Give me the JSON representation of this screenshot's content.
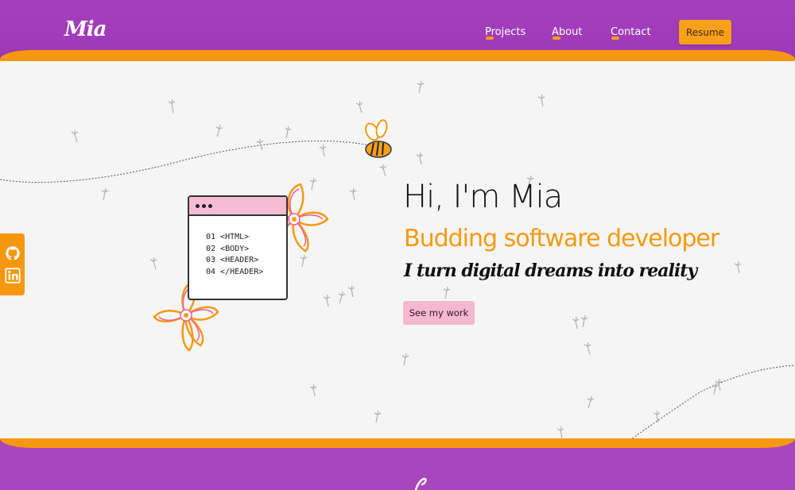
{
  "header": {
    "logo": "Mia",
    "nav": [
      {
        "label": "Projects"
      },
      {
        "label": "About"
      },
      {
        "label": "Contact"
      }
    ],
    "resume_label": "Resume"
  },
  "hero": {
    "greeting": "Hi, I'm Mia",
    "role": "Budding software developer",
    "tagline": "I turn digital dreams into reality",
    "cta_label": "See my work",
    "code_lines": [
      "01 <HTML>",
      "02 <BODY>",
      "03 <HEADER>",
      "04 </HEADER>"
    ]
  },
  "social": {
    "icons": [
      "github-icon",
      "linkedin-icon"
    ]
  },
  "colors": {
    "purple": "#a540bd",
    "orange": "#f6980f",
    "pink": "#f6b8cf",
    "background": "#f5f5f5"
  }
}
